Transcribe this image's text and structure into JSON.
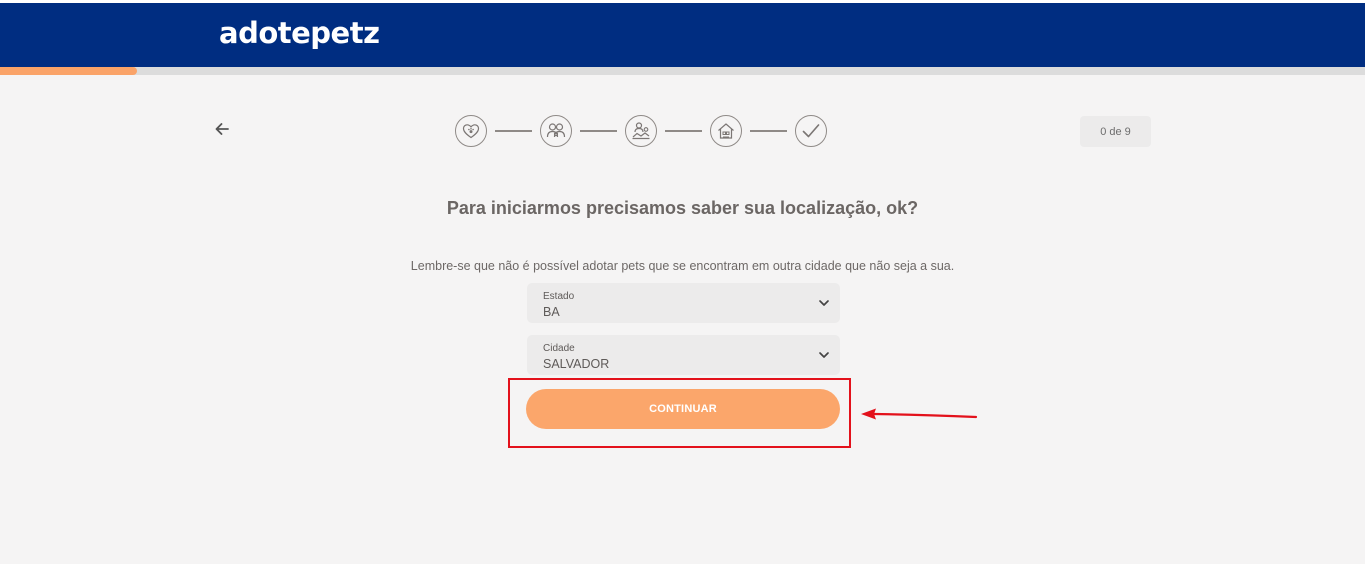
{
  "header": {
    "logo_text": "adotepetz",
    "progress_fraction": 0.1
  },
  "nav": {
    "back_icon": "arrow-left-icon"
  },
  "stepper": {
    "steps": [
      {
        "icon": "heart-paw-icon"
      },
      {
        "icon": "family-icon"
      },
      {
        "icon": "pet-care-icon"
      },
      {
        "icon": "home-icon"
      },
      {
        "icon": "check-icon"
      }
    ],
    "counter": "0 de 9"
  },
  "form": {
    "title": "Para iniciarmos precisamos saber sua localização, ok?",
    "hint": "Lembre-se que não é possível adotar pets que se encontram em outra cidade que não seja a sua.",
    "estado": {
      "label": "Estado",
      "value": "BA"
    },
    "cidade": {
      "label": "Cidade",
      "value": "SALVADOR"
    },
    "continue_label": "CONTINUAR"
  },
  "colors": {
    "header_bg": "#002d81",
    "accent": "#fba66b",
    "annotation": "#e3111b",
    "page_bg": "#f5f4f4"
  }
}
